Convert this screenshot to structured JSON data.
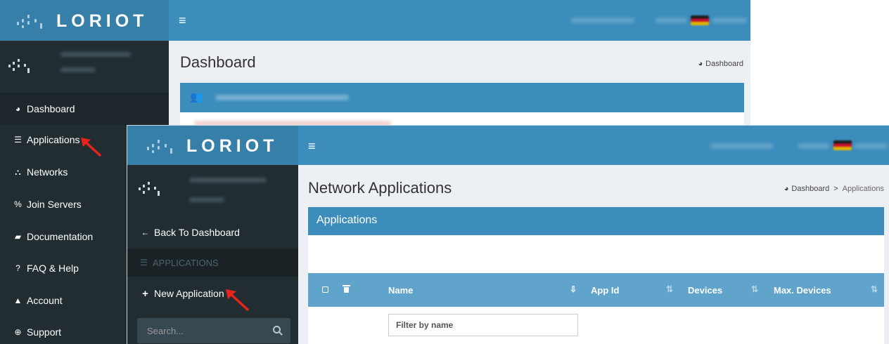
{
  "back": {
    "logo_text": "LORIOT",
    "menu_toggle": "≡",
    "page_title": "Dashboard",
    "breadcrumb": {
      "home": "Dashboard"
    },
    "menu": [
      {
        "label": "Dashboard",
        "icon": "dashboard-icon",
        "glyph": "◕"
      },
      {
        "label": "Applications",
        "icon": "list-icon",
        "glyph": "☰"
      },
      {
        "label": "Networks",
        "icon": "sitemap-icon",
        "glyph": "⛬"
      },
      {
        "label": "Join Servers",
        "icon": "percent-icon",
        "glyph": "%"
      },
      {
        "label": "Documentation",
        "icon": "book-icon",
        "glyph": "▰"
      },
      {
        "label": "FAQ & Help",
        "icon": "question-icon",
        "glyph": "?"
      },
      {
        "label": "Account",
        "icon": "user-icon",
        "glyph": "▲"
      },
      {
        "label": "Support",
        "icon": "lifebuoy-icon",
        "glyph": "⊕"
      }
    ]
  },
  "front": {
    "logo_text": "LORIOT",
    "menu_toggle": "≡",
    "page_title": "Network Applications",
    "breadcrumb": {
      "home": "Dashboard",
      "separator": ">",
      "current": "Applications"
    },
    "sidebar": {
      "back_link": "Back To Dashboard",
      "section_header": "APPLICATIONS",
      "new_app": "New Application",
      "search_placeholder": "Search..."
    },
    "box_title": "Applications",
    "table": {
      "columns": [
        "Name",
        "App Id",
        "Devices",
        "Max. Devices"
      ],
      "filter_placeholder": "Filter by name"
    }
  },
  "colors": {
    "accent": "#3c8dbc",
    "sidebar": "#222d32",
    "annotation_arrow": "#e8231b"
  }
}
